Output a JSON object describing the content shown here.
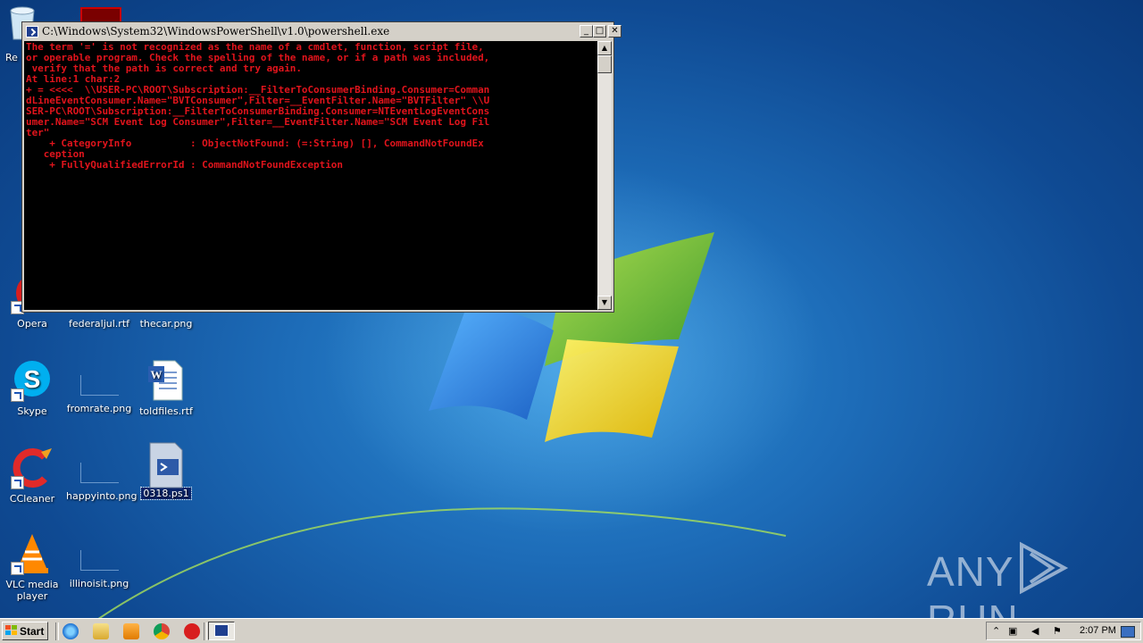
{
  "console": {
    "title": "C:\\Windows\\System32\\WindowsPowerShell\\v1.0\\powershell.exe",
    "output": "The term '=' is not recognized as the name of a cmdlet, function, script file,\nor operable program. Check the spelling of the name, or if a path was included,\n verify that the path is correct and try again.\nAt line:1 char:2\n+ = <<<<  \\\\USER-PC\\ROOT\\Subscription:__FilterToConsumerBinding.Consumer=Comman\ndLineEventConsumer.Name=\"BVTConsumer\",Filter=__EventFilter.Name=\"BVTFilter\" \\\\U\nSER-PC\\ROOT\\Subscription:__FilterToConsumerBinding.Consumer=NTEventLogEventCons\numer.Name=\"SCM Event Log Consumer\",Filter=__EventFilter.Name=\"SCM Event Log Fil\nter\"\n    + CategoryInfo          : ObjectNotFound: (=:String) [], CommandNotFoundEx\n   ception\n    + FullyQualifiedErrorId : CommandNotFoundException",
    "buttons": {
      "minimize": "_",
      "maximize": "□",
      "close": "✕"
    }
  },
  "desktop": {
    "icons": [
      {
        "label": "Re",
        "icon": "recycle-bin-icon"
      },
      {
        "label": "Opera",
        "icon": "opera-icon"
      },
      {
        "label": "federaljul.rtf",
        "icon": "rtf-file-icon"
      },
      {
        "label": "thecar.png",
        "icon": "png-file-icon"
      },
      {
        "label": "Skype",
        "icon": "skype-icon"
      },
      {
        "label": "fromrate.png",
        "icon": "png-file-icon"
      },
      {
        "label": "toldfiles.rtf",
        "icon": "word-document-icon"
      },
      {
        "label": "CCleaner",
        "icon": "ccleaner-icon"
      },
      {
        "label": "happyinto.png",
        "icon": "png-file-icon"
      },
      {
        "label": "0318.ps1",
        "icon": "powershell-script-icon"
      },
      {
        "label": "VLC media player",
        "icon": "vlc-icon"
      },
      {
        "label": "illinoisit.png",
        "icon": "png-file-icon"
      }
    ]
  },
  "taskbar": {
    "start_label": "Start",
    "quick_launch": [
      "internet-explorer-icon",
      "explorer-folder-icon",
      "media-player-icon",
      "chrome-icon",
      "opera-icon"
    ],
    "task_icon": "powershell-icon",
    "tray_icons": [
      "show-hidden-icon",
      "network-icon",
      "volume-icon",
      "flag-icon"
    ],
    "clock": "2:07 PM"
  },
  "watermark": {
    "text_left": "ANY",
    "text_right": "RUN"
  },
  "colors": {
    "console_text": "#e1141c",
    "console_bg": "#000000",
    "desktop": "#1d6cb8",
    "selection": "#0a246a"
  }
}
